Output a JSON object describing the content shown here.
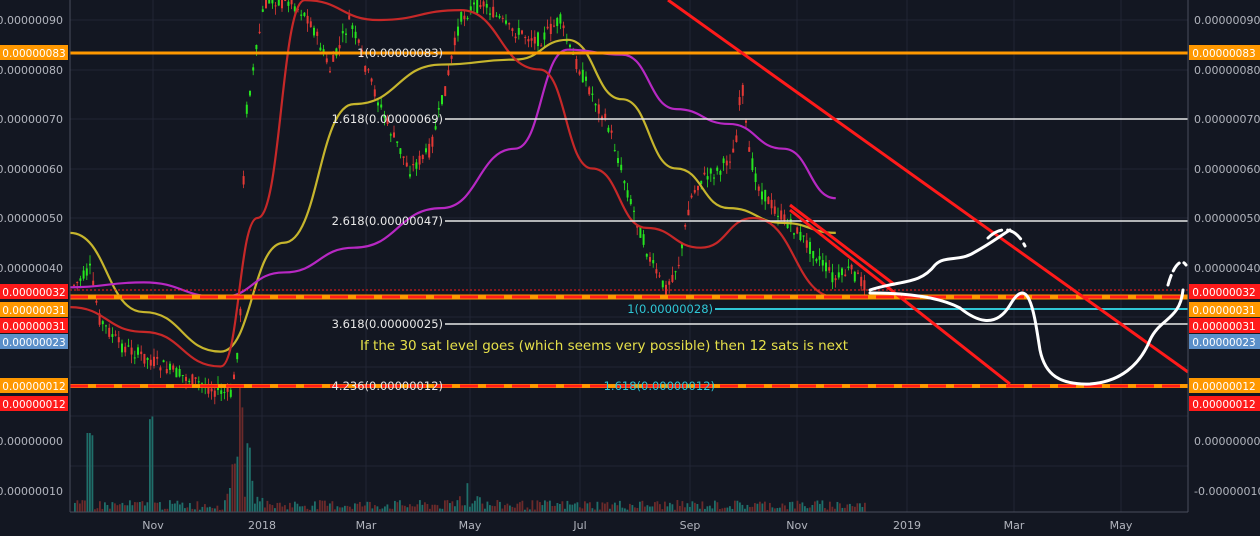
{
  "chart_data": {
    "type": "line",
    "title": "",
    "xlabel": "",
    "ylabel": "",
    "colors": {
      "background": "#131722",
      "grid": "#222634",
      "axis_text": "#b2b5be",
      "candle_up": "#26e51f",
      "candle_down": "#e53935",
      "ma_fast": "#c62828",
      "ma_mid": "#c6b52d",
      "ma_slow": "#b728c3",
      "trend": "#ff1a1a",
      "fib_line": "#e8e8e8",
      "fib_ext": "#2fc7d6",
      "annotation": "#e6e04a",
      "hline_orange": "#ff9800",
      "hline_red": "#ff1a1a",
      "doodle": "#ffffff"
    },
    "y_ticks": [
      "0.00000090",
      "0.00000080",
      "0.00000070",
      "0.00000060",
      "0.00000050",
      "0.00000040",
      "0.00000000",
      "-0.00000010"
    ],
    "x_ticks": [
      "Nov",
      "2018",
      "Mar",
      "May",
      "Jul",
      "Sep",
      "Nov",
      "2019",
      "Mar",
      "May"
    ],
    "price_badges": [
      {
        "text": "0.00000083",
        "color": "#ff9800"
      },
      {
        "text": "0.00000032",
        "color": "#ff1a1a"
      },
      {
        "text": "0.00000031",
        "color": "#ff9800"
      },
      {
        "text": "0.00000031",
        "color": "#ff1a1a"
      },
      {
        "text": "0.00000023",
        "color": "#5b8fc9"
      },
      {
        "text": "0.00000012",
        "color": "#ff9800"
      },
      {
        "text": "0.00000012",
        "color": "#ff1a1a"
      }
    ],
    "fib_labels": [
      "1(0.00000083)",
      "1.618(0.00000069)",
      "2.618(0.00000047)",
      "3.618(0.00000025)",
      "4.236(0.00000012)",
      "1(0.00000028)",
      "1.618(0.00000012)"
    ],
    "annotation": "If the 30 sat level goes (which seems very possible) then 12 sats is next",
    "series": [
      {
        "name": "",
        "color": "#c6b52d",
        "x": [
          "2017-09-20",
          "2017-11-01",
          "2017-12-15",
          "2018-01-20",
          "2018-03-01",
          "2018-04-20",
          "2018-06-01",
          "2018-07-01",
          "2018-08-01",
          "2018-09-01",
          "2018-10-01",
          "2018-11-01",
          "2018-12-01"
        ],
        "values": [
          4.7e-07,
          3.1e-07,
          2.3e-07,
          4.5e-07,
          7.3e-07,
          8.1e-07,
          8.2e-07,
          8.6e-07,
          7.4e-07,
          6e-07,
          5.2e-07,
          4.9e-07,
          4.7e-07
        ]
      },
      {
        "name": "",
        "color": "#b728c3",
        "x": [
          "2017-09-20",
          "2017-11-01",
          "2017-12-15",
          "2018-01-20",
          "2018-03-01",
          "2018-04-20",
          "2018-06-01",
          "2018-07-01",
          "2018-08-01",
          "2018-09-01",
          "2018-10-01",
          "2018-11-01",
          "2018-12-01"
        ],
        "values": [
          3.6e-07,
          3.7e-07,
          3.4e-07,
          3.9e-07,
          4.4e-07,
          5.2e-07,
          6.4e-07,
          8.4e-07,
          8.3e-07,
          7.2e-07,
          6.9e-07,
          6.4e-07,
          5.4e-07
        ]
      },
      {
        "name": "",
        "color": "#c62828",
        "x": [
          "2017-09-20",
          "2017-11-01",
          "2017-12-15",
          "2018-01-05",
          "2018-02-01",
          "2018-03-15",
          "2018-05-01",
          "2018-06-15",
          "2018-07-15",
          "2018-08-15",
          "2018-09-15",
          "2018-10-15",
          "2018-12-01"
        ],
        "values": [
          3.2e-07,
          2.7e-07,
          2e-07,
          5e-07,
          9.4e-07,
          9e-07,
          9.2e-07,
          8e-07,
          6e-07,
          4.8e-07,
          4.4e-07,
          5e-07,
          3.4e-07
        ]
      }
    ]
  }
}
